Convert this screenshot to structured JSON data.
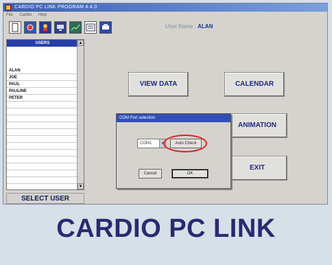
{
  "window": {
    "title": "CARDIO PC LINK PROGRAM 4.4.0",
    "menu": [
      "File",
      "Cardio",
      "Help"
    ]
  },
  "toolbar": {
    "user_label": "User Name :",
    "user_name": "ALAN",
    "icons": [
      "new-document-icon",
      "settings-icon",
      "heart-icon",
      "monitor-icon",
      "chart-icon",
      "report-icon",
      "print-icon"
    ]
  },
  "users": {
    "header": "USERS",
    "items": [
      "ALAN",
      "JOE",
      "PAUL",
      "PAULINE",
      "PETER"
    ],
    "select_label": "SELECT USER"
  },
  "buttons": {
    "view_data": "VIEW DATA",
    "calendar": "CALENDAR",
    "animation": "ANIMATION",
    "exit": "EXIT"
  },
  "dialog": {
    "title": "COM Port selection",
    "port": "COM1",
    "auto_check": "Auto Check",
    "cancel": "Cancel",
    "ok": "OK"
  },
  "banner": "CARDIO PC LINK",
  "colors": {
    "accent": "#2a3ea8",
    "highlight_ring": "#e02020"
  }
}
